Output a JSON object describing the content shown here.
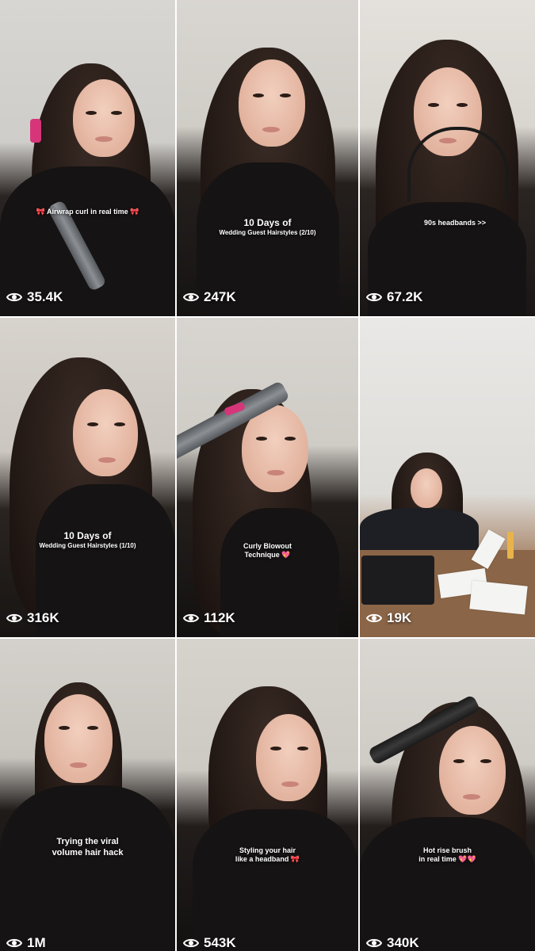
{
  "tiles": [
    {
      "caption_lines": [
        "🎀 Airwrap curl in real time 🎀"
      ],
      "views": "35.4K"
    },
    {
      "caption_big": "10 Days of",
      "caption_small": "Wedding Guest Hairstyles (2/10)",
      "views": "247K"
    },
    {
      "caption_lines": [
        "90s headbands >>"
      ],
      "views": "67.2K"
    },
    {
      "caption_big": "10 Days of",
      "caption_small": "Wedding Guest Hairstyles (1/10)",
      "views": "316K"
    },
    {
      "caption_lines": [
        "Curly Blowout",
        "Technique 💖"
      ],
      "views": "112K"
    },
    {
      "views": "19K"
    },
    {
      "caption_lines": [
        "Trying the viral",
        "volume hair hack"
      ],
      "views": "1M"
    },
    {
      "caption_lines": [
        "Styling your hair",
        "like a headband 🎀"
      ],
      "views": "543K"
    },
    {
      "caption_lines": [
        "Hot rise brush",
        "in real time 💖💖"
      ],
      "views": "340K"
    }
  ],
  "icons": {
    "views_icon": "eye-icon"
  },
  "colors": {
    "overlay_text": "#ffffff",
    "pink_accent": "#d6357a"
  }
}
